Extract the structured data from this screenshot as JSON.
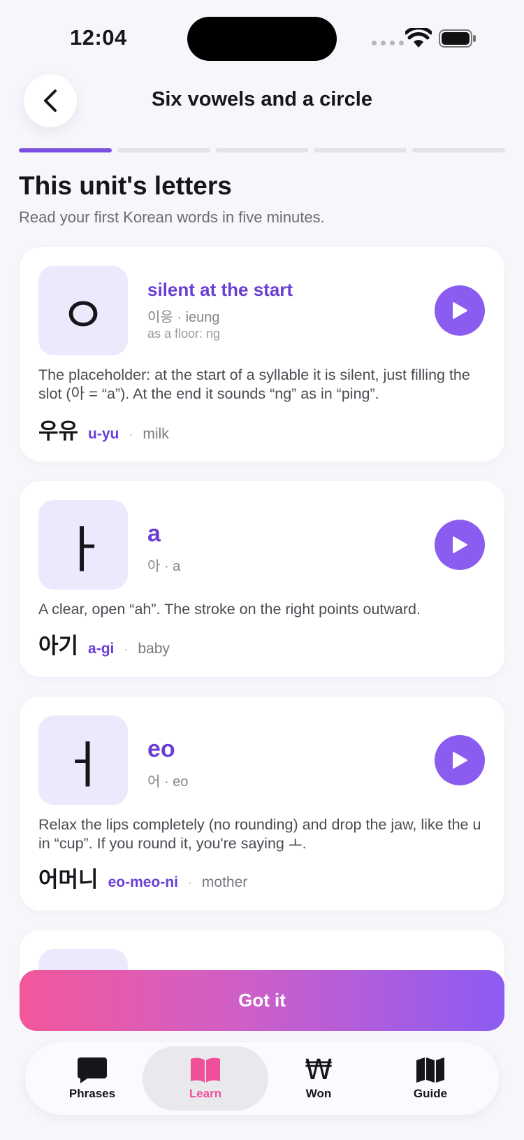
{
  "status_bar": {
    "time": "12:04"
  },
  "header": {
    "title": "Six vowels and a circle"
  },
  "progress": {
    "total_steps": 5,
    "current_step": 1
  },
  "section": {
    "title": "This unit's letters",
    "subtitle": "Read your first Korean words in five minutes."
  },
  "cards": [
    {
      "glyph": "ㅇ",
      "name": "silent at the start",
      "meta": "이응 · ieung",
      "meta2": "as a floor: ng",
      "description": "The placeholder: at the start of a syllable it is silent, just filling the slot (아 = “a”). At the end it sounds “ng” as in “ping”.",
      "example": {
        "word": "우유",
        "roman": "u-yu",
        "meaning": "milk"
      }
    },
    {
      "glyph": "ㅏ",
      "name": "a",
      "meta": "아 · a",
      "description": "A clear, open “ah”. The stroke on the right points outward.",
      "example": {
        "word": "아기",
        "roman": "a-gi",
        "meaning": "baby"
      }
    },
    {
      "glyph": "ㅓ",
      "name": "eo",
      "meta": "어 · eo",
      "description": "Relax the lips completely (no rounding) and drop the jaw, like the u in “cup”. If you round it, you're saying ㅗ.",
      "example": {
        "word": "어머니",
        "roman": "eo-meo-ni",
        "meaning": "mother"
      }
    }
  ],
  "example_separator": "·",
  "cta": {
    "label": "Got it"
  },
  "tabs": [
    {
      "label": "Phrases",
      "icon": "speech-bubble-icon",
      "active": false
    },
    {
      "label": "Learn",
      "icon": "book-icon",
      "active": true
    },
    {
      "label": "Won",
      "icon": "won-sign-icon",
      "glyph": "₩",
      "active": false
    },
    {
      "label": "Guide",
      "icon": "map-icon",
      "active": false
    }
  ],
  "colors": {
    "accent": "#6a3fd4",
    "play": "#8b5cf0",
    "glyph_bg": "#ede9fc",
    "active_tab": "#f0509a",
    "cta_gradient": [
      "#f3579b",
      "#8c5cf2"
    ]
  }
}
